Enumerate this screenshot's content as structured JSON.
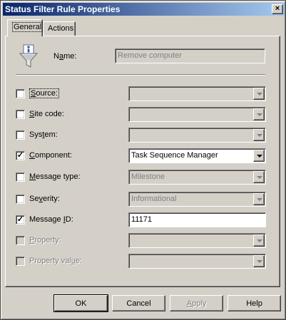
{
  "window": {
    "title": "Status Filter Rule Properties",
    "close_glyph": "×"
  },
  "tabs": [
    {
      "label": "General",
      "active": true
    },
    {
      "label": "Actions",
      "active": false
    }
  ],
  "name": {
    "label_pre": "N",
    "label_u": "a",
    "label_post": "me:",
    "value": "Remove computer",
    "icon": "filter-info-icon"
  },
  "rows": [
    {
      "pre": "",
      "u": "S",
      "post": "ource:",
      "checked": false,
      "enabled": true,
      "control": "combo",
      "value": "",
      "control_enabled": false
    },
    {
      "pre": "",
      "u": "S",
      "post": "ite code:",
      "checked": false,
      "enabled": true,
      "control": "combo",
      "value": "",
      "control_enabled": false
    },
    {
      "pre": "Sys",
      "u": "t",
      "post": "em:",
      "checked": false,
      "enabled": true,
      "control": "combo",
      "value": "",
      "control_enabled": false
    },
    {
      "pre": "",
      "u": "C",
      "post": "omponent:",
      "checked": true,
      "enabled": true,
      "control": "combo",
      "value": "Task Sequence Manager",
      "control_enabled": true
    },
    {
      "pre": "",
      "u": "M",
      "post": "essage type:",
      "checked": false,
      "enabled": true,
      "control": "combo",
      "value": "Milestone",
      "control_enabled": false
    },
    {
      "pre": "Se",
      "u": "v",
      "post": "erity:",
      "checked": false,
      "enabled": true,
      "control": "combo",
      "value": "Informational",
      "control_enabled": false
    },
    {
      "pre": "Message ",
      "u": "I",
      "post": "D:",
      "checked": true,
      "enabled": true,
      "control": "text",
      "value": "11171",
      "control_enabled": true
    },
    {
      "pre": "",
      "u": "P",
      "post": "roperty:",
      "checked": false,
      "enabled": false,
      "control": "combo",
      "value": "",
      "control_enabled": false
    },
    {
      "pre": "Property val",
      "u": "u",
      "post": "e:",
      "checked": false,
      "enabled": false,
      "control": "combo",
      "value": "",
      "control_enabled": false
    }
  ],
  "buttons": {
    "ok": "OK",
    "cancel": "Cancel",
    "apply_pre": "",
    "apply_u": "A",
    "apply_post": "pply",
    "help": "Help"
  },
  "colors": {
    "face": "#d4d0c8",
    "title_start": "#0a246a",
    "title_end": "#a6caf0",
    "disabled_text": "#808080"
  }
}
